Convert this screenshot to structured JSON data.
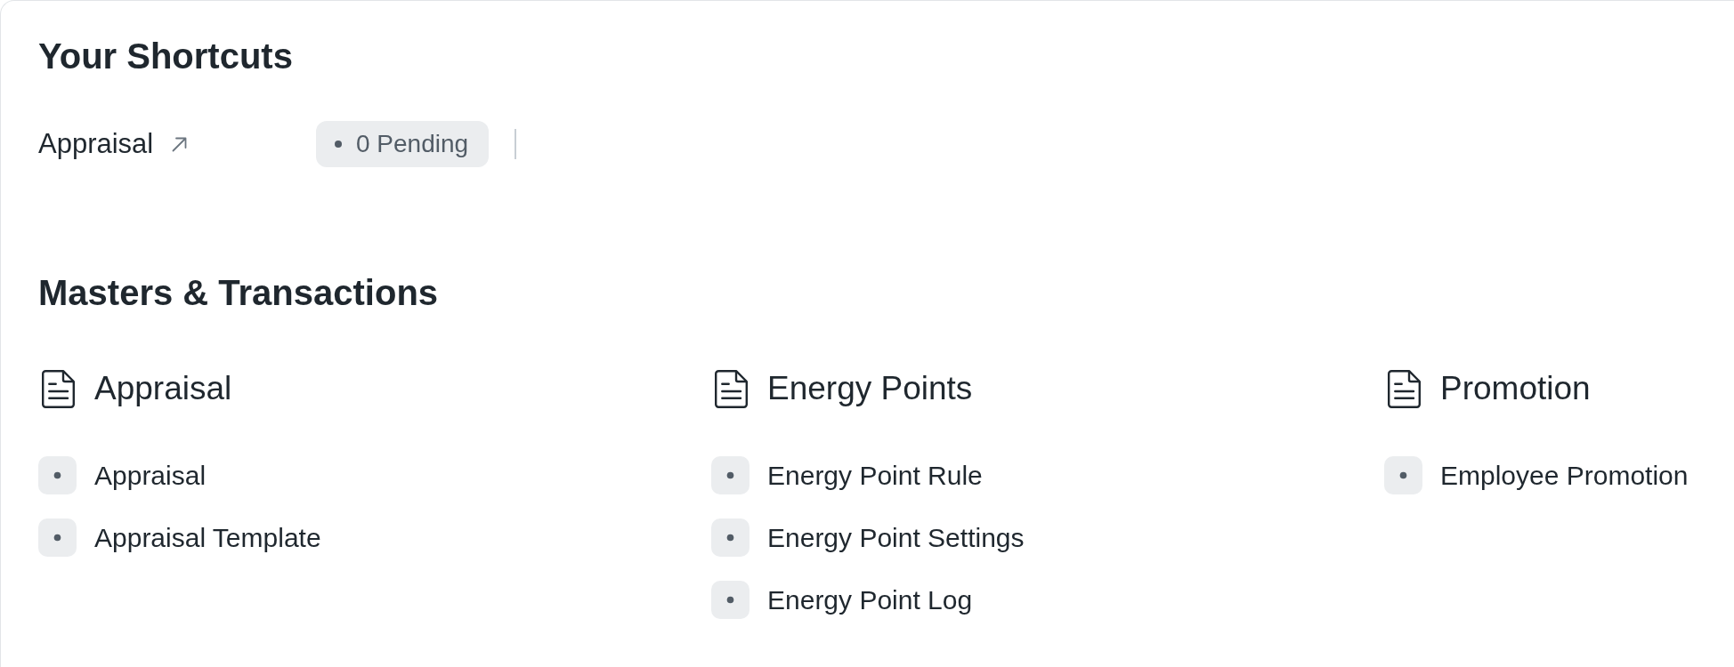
{
  "shortcuts": {
    "title": "Your Shortcuts",
    "items": [
      {
        "label": "Appraisal",
        "count": "0 Pending"
      }
    ]
  },
  "masters": {
    "title": "Masters & Transactions",
    "cards": [
      {
        "title": "Appraisal",
        "links": [
          "Appraisal",
          "Appraisal Template"
        ]
      },
      {
        "title": "Energy Points",
        "links": [
          "Energy Point Rule",
          "Energy Point Settings",
          "Energy Point Log"
        ]
      },
      {
        "title": "Promotion",
        "links": [
          "Employee Promotion"
        ]
      }
    ]
  }
}
